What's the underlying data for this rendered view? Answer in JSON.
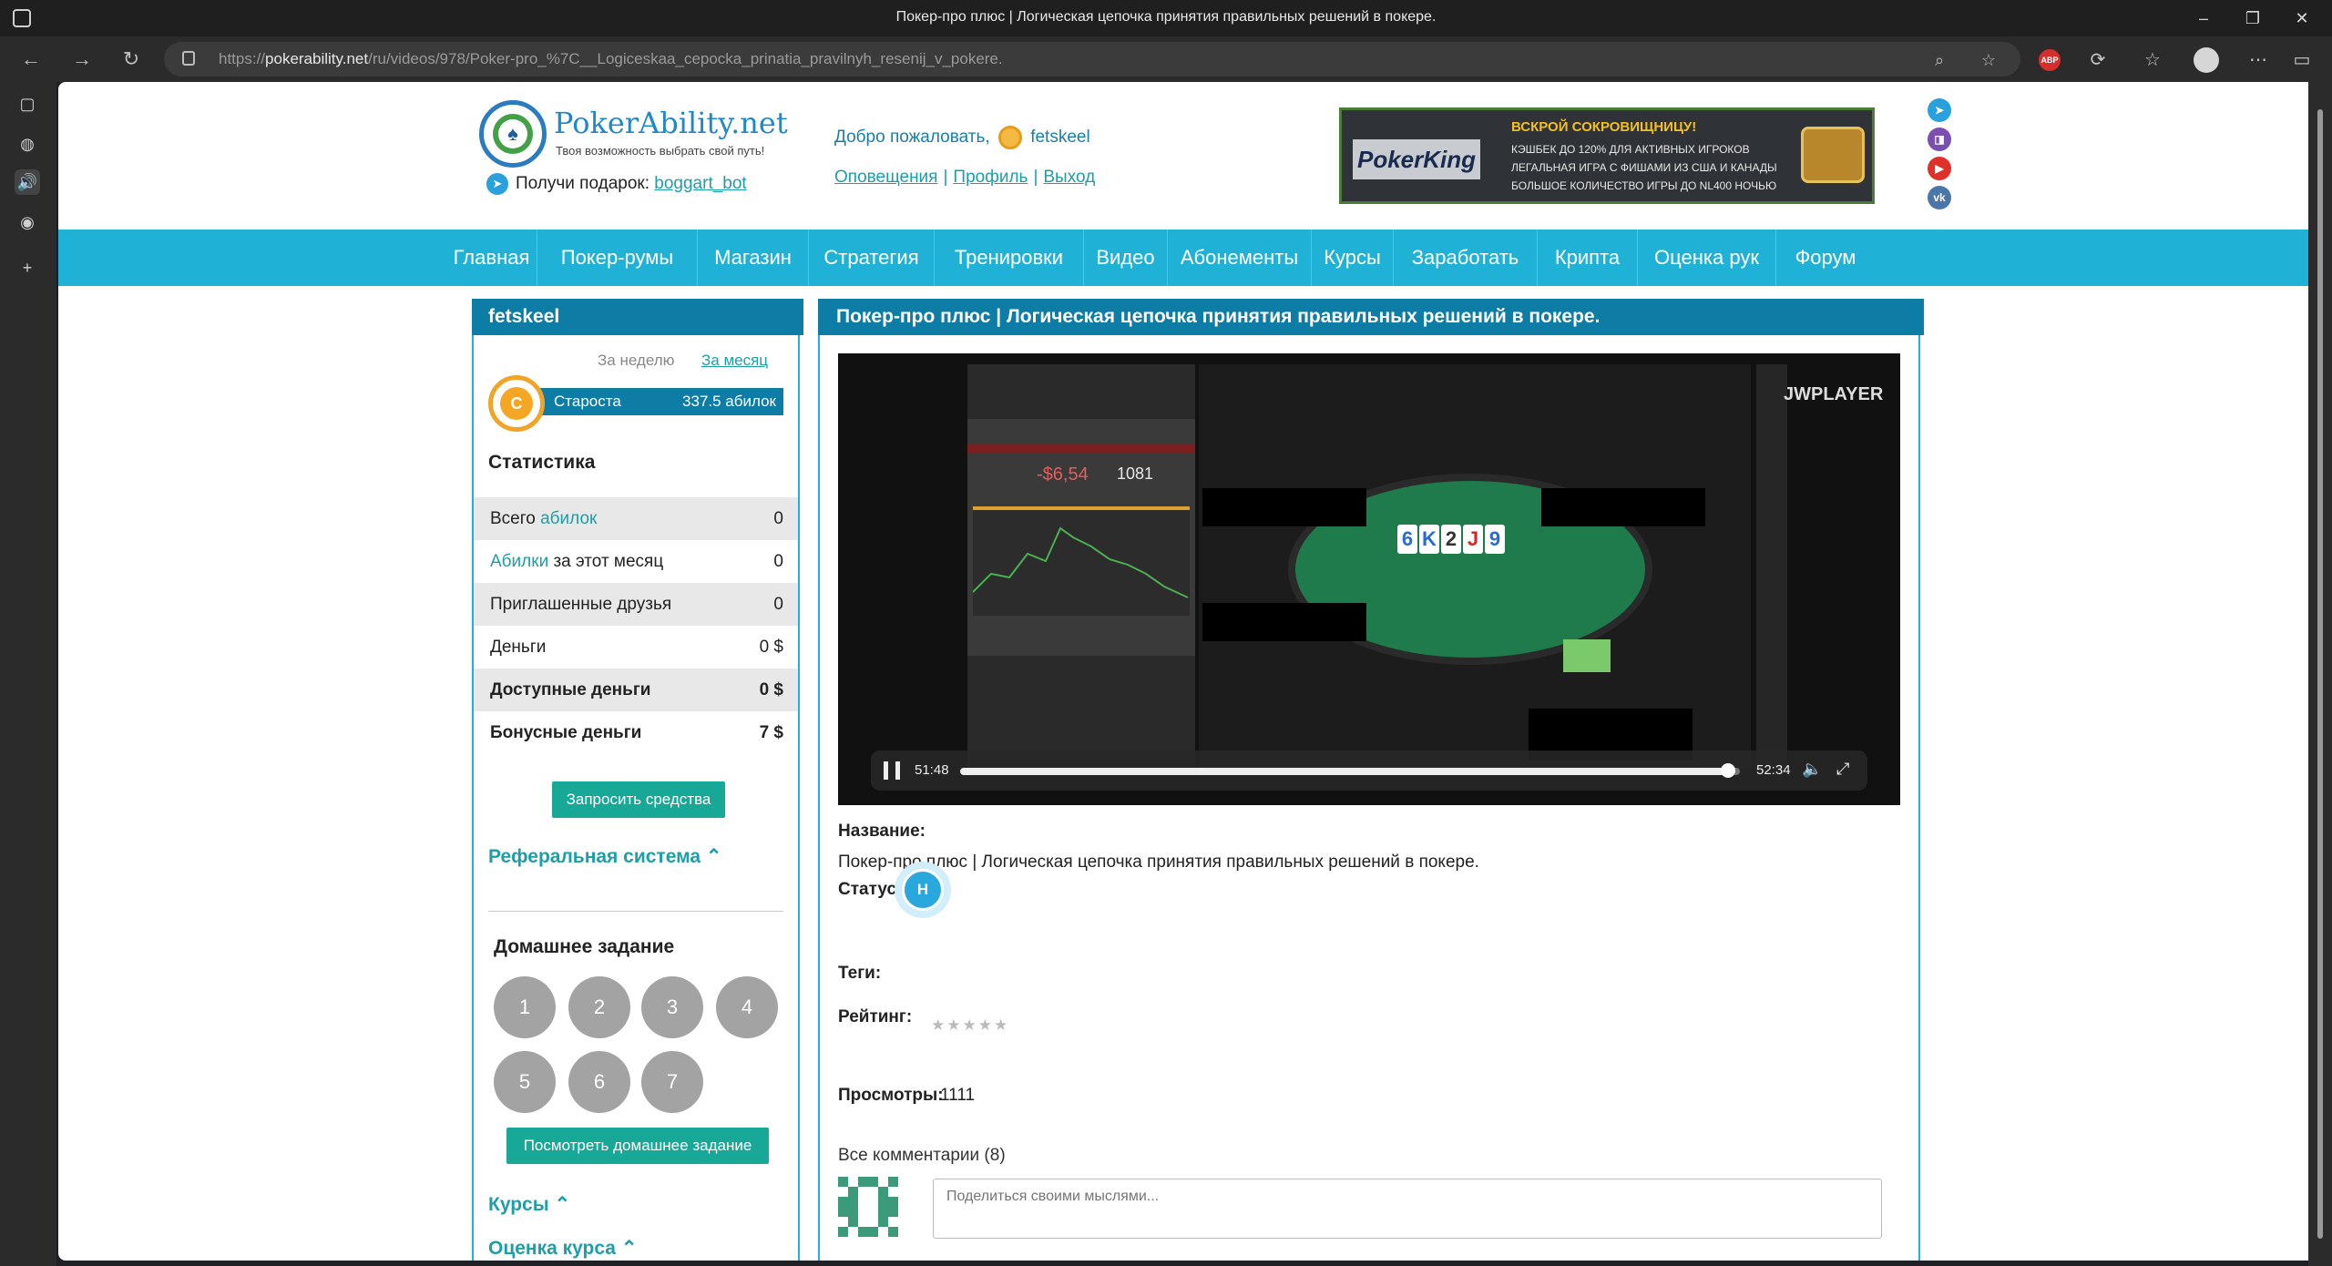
{
  "browser": {
    "tab_title": "Покер-про плюс | Логическая цепочка принятия правильных решений в покере.",
    "url_prefix": "https://",
    "url_domain": "pokerability.net",
    "url_path": "/ru/videos/978/Poker-pro_%7C__Logiceskaa_cepocka_prinatia_pravilnyh_resenij_v_pokere.",
    "abp_label": "ABP"
  },
  "header": {
    "logo_text": "PokerAbility.net",
    "logo_tagline": "Твоя возможность выбрать свой путь!",
    "gift_label": "Получи подарок:",
    "gift_link": "boggart_bot",
    "welcome_label": "Добро пожаловать,",
    "username": "fetskeel",
    "links": [
      "Оповещения",
      "Профиль",
      "Выход"
    ],
    "link_separator": "|"
  },
  "banner": {
    "brand": "PokerKing",
    "headline": "ВСКРОЙ СОКРОВИЩНИЦУ!",
    "lines": [
      "КЭШБЕК ДО 120% ДЛЯ АКТИВНЫХ ИГРОКОВ",
      "ЛЕГАЛЬНАЯ ИГРА С ФИШАМИ ИЗ США И КАНАДЫ",
      "БОЛЬШОЕ КОЛИЧЕСТВО ИГРЫ ДО NL400 НОЧЬЮ"
    ]
  },
  "social": [
    {
      "name": "telegram-icon",
      "color": "#2aa0dc"
    },
    {
      "name": "twitch-icon",
      "color": "#7a4fb0"
    },
    {
      "name": "youtube-icon",
      "color": "#e0302a"
    },
    {
      "name": "vk-icon",
      "color": "#4a76a8"
    }
  ],
  "nav": [
    "Главная",
    "Покер-румы",
    "Магазин",
    "Стратегия",
    "Тренировки",
    "Видео",
    "Абонементы",
    "Курсы",
    "Заработать",
    "Крипта",
    "Оценка рук",
    "Форум"
  ],
  "user_panel": {
    "title": "fetskeel",
    "period_week": "За неделю",
    "period_month": "За месяц",
    "rank_badge": "С",
    "rank_name": "Староста",
    "rank_value": "337.5 абилок",
    "stats_title": "Статистика",
    "stats": [
      {
        "pre": "Всего ",
        "link": "абилок",
        "post": "",
        "value": "0",
        "bold": false
      },
      {
        "pre": "",
        "link": "Абилки",
        "post": " за этот месяц",
        "value": "0",
        "bold": false
      },
      {
        "pre": "Приглашенные друзья",
        "link": "",
        "post": "",
        "value": "0",
        "bold": false
      },
      {
        "pre": "Деньги",
        "link": "",
        "post": "",
        "value": "0 $",
        "bold": false
      },
      {
        "pre": "Доступные деньги",
        "link": "",
        "post": "",
        "value": "0 $",
        "bold": true
      },
      {
        "pre": "Бонусные деньги",
        "link": "",
        "post": "",
        "value": "7 $",
        "bold": true
      }
    ],
    "withdraw_button": "Запросить средства",
    "referral_link": "Реферальная система",
    "homework_title": "Домашнее задание",
    "homework_items": [
      "1",
      "2",
      "3",
      "4",
      "5",
      "6",
      "7"
    ],
    "homework_button": "Посмотреть домашнее задание",
    "courses_link": "Курсы",
    "course_rating_link": "Оценка курса"
  },
  "video_panel": {
    "title": "Покер-про плюс | Логическая цепочка принятия правильных решений в покере.",
    "player": {
      "brand": "JWPLAYER",
      "time_current": "51:48",
      "time_total": "52:34",
      "progress": 0.985,
      "hm_value": "-$6,54",
      "hm_hands": "1081",
      "board": [
        "6",
        "K",
        "2",
        "J",
        "9"
      ]
    },
    "name_label": "Название:",
    "name_value": "Покер-про плюс |  Логическая цепочка принятия правильных решений в покере.",
    "status_label": "Статус :",
    "status_badge": "Н",
    "tags_label": "Теги:",
    "rating_label": "Рейтинг:",
    "rating_stars": "★★★★★",
    "views_label": "Просмотры:",
    "views_value": "1111",
    "comments_title": "Все комментарии (8)",
    "comment_placeholder": "Поделиться своими мыслями..."
  },
  "colors": {
    "nav_bg": "#1fb2d6",
    "header_bar": "#0d7da5",
    "button_teal": "#17a897",
    "link": "#1e9ea8"
  }
}
